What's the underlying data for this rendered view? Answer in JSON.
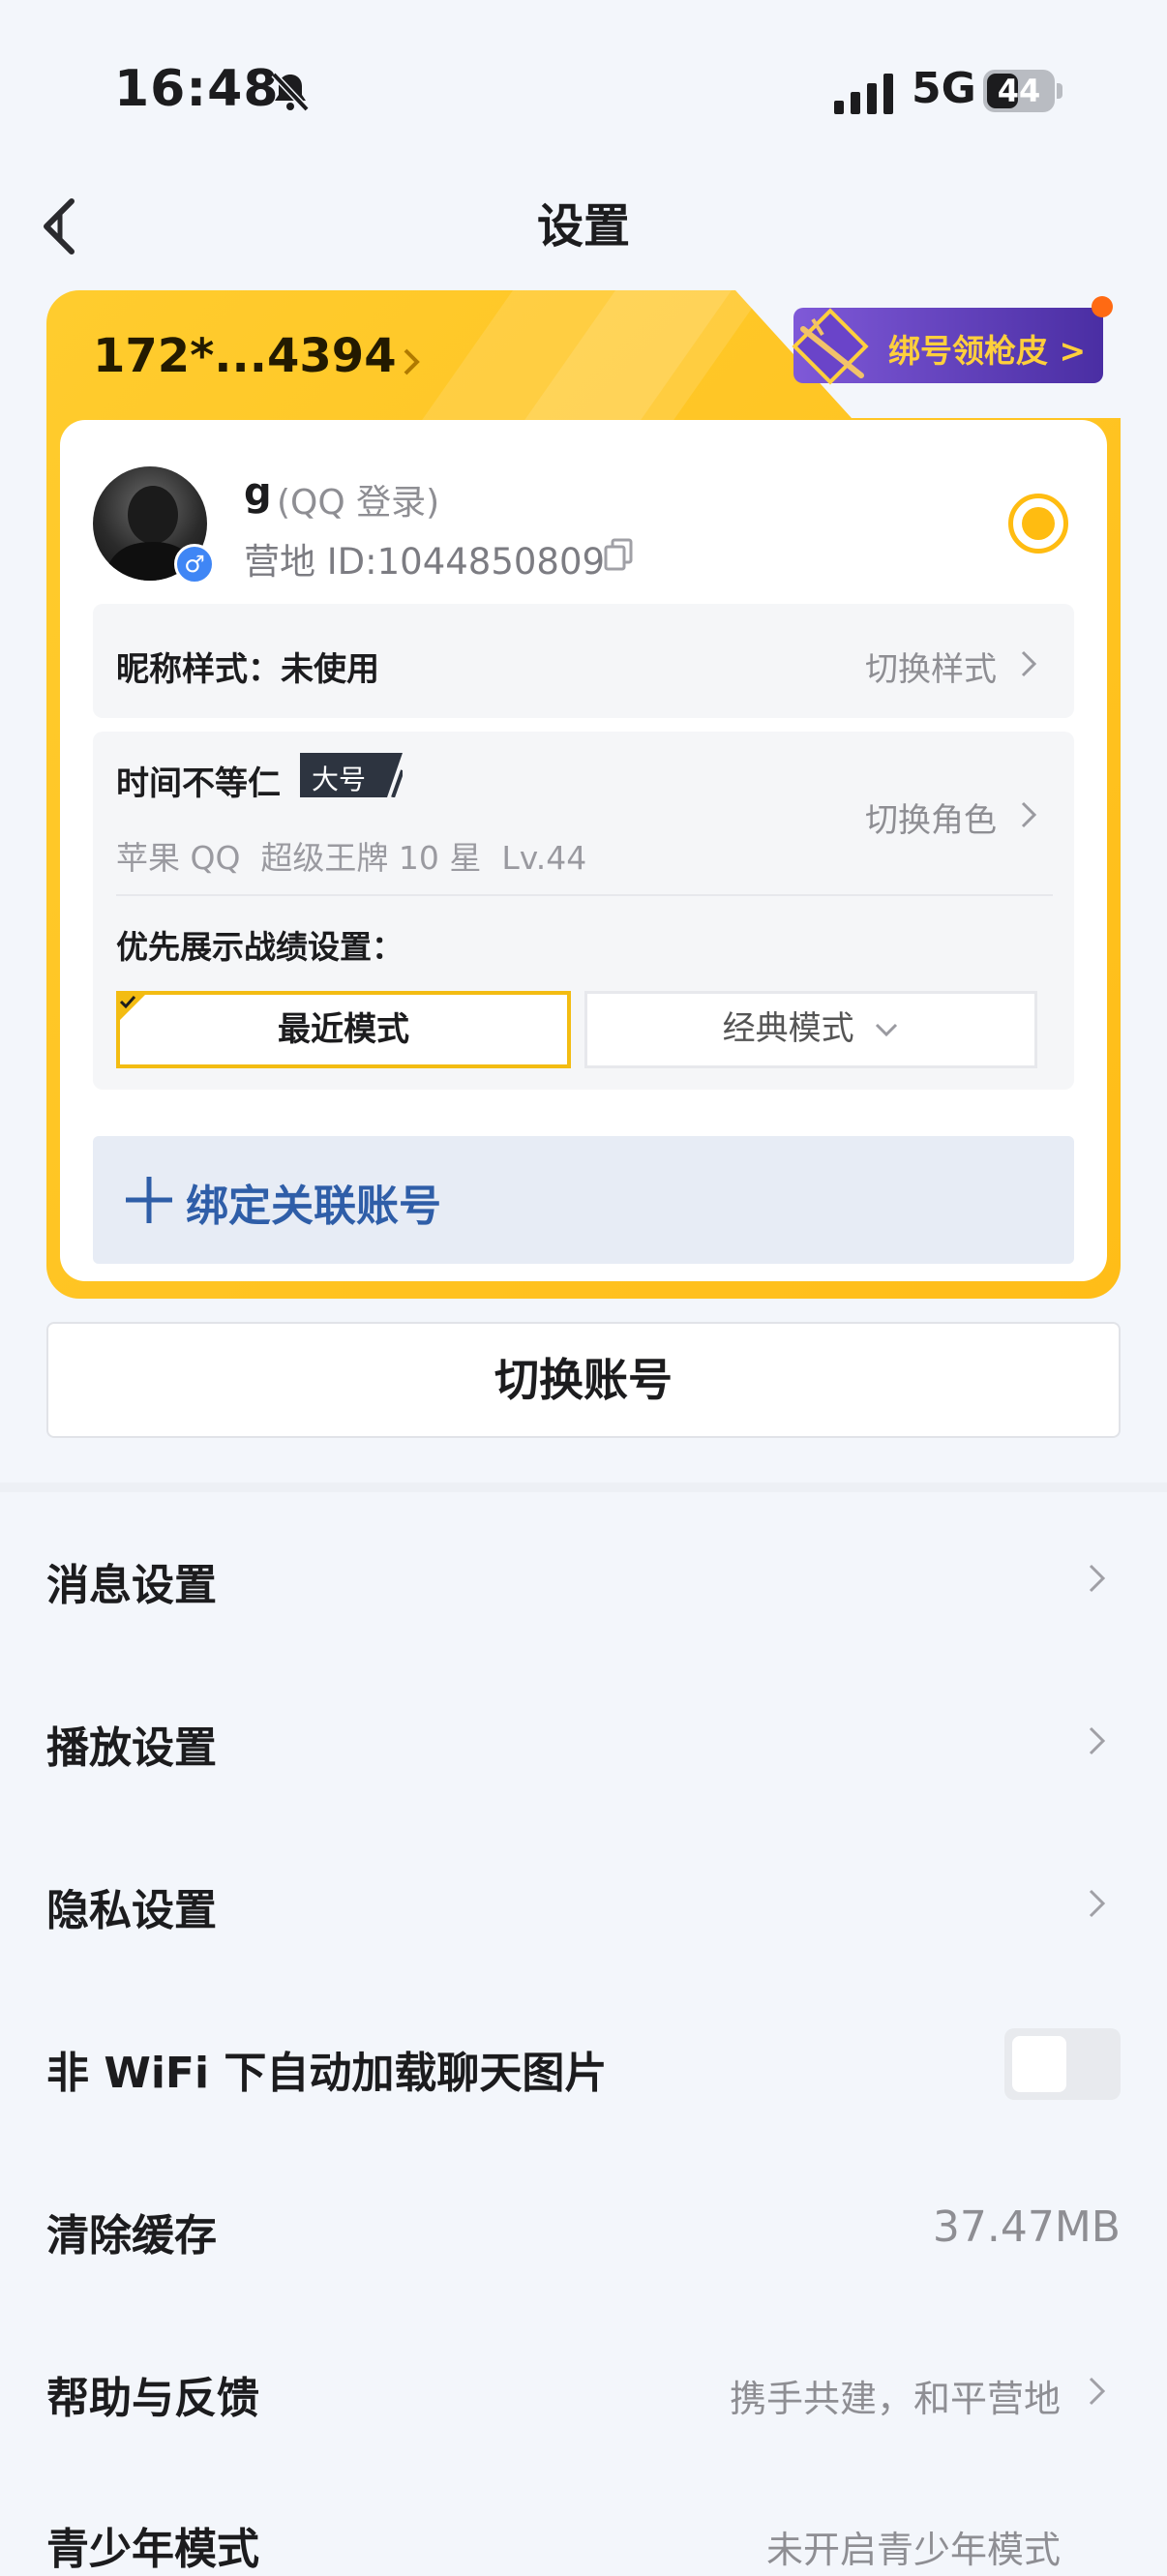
{
  "status_bar": {
    "time": "16:48",
    "network": "5G",
    "battery": "44"
  },
  "header": {
    "title": "设置"
  },
  "account_card": {
    "phone": "172*...4394",
    "promo_label": "绑号领枪皮 >",
    "user_name": "g",
    "login_type": "(QQ 登录)",
    "camp_id": "营地 ID:1044850809",
    "nickname_style_label": "昵称样式：未使用",
    "nickname_style_action": "切换样式",
    "role_name": "时间不等仁",
    "role_badge": "大号",
    "role_desc": "苹果 QQ  超级王牌 10 星  Lv.44",
    "role_action": "切换角色",
    "record_label": "优先展示战绩设置：",
    "mode_recent": "最近模式",
    "mode_classic": "经典模式",
    "bind_label": "绑定关联账号"
  },
  "switch_account": "切换账号",
  "menu": {
    "message": "消息设置",
    "playback": "播放设置",
    "privacy": "隐私设置",
    "wifi_images": "非 WiFi 下自动加载聊天图片",
    "clear_cache": "清除缓存",
    "cache_size": "37.47MB",
    "help": "帮助与反馈",
    "help_value": "携手共建，和平营地",
    "partial": "青少年模式",
    "partial_value": "未开启青少年模式"
  },
  "wifi_images_enabled": false,
  "colors": {
    "accent_yellow": "#ffbc11",
    "link_blue": "#2f5ea8",
    "background": "#f3f6fb"
  }
}
